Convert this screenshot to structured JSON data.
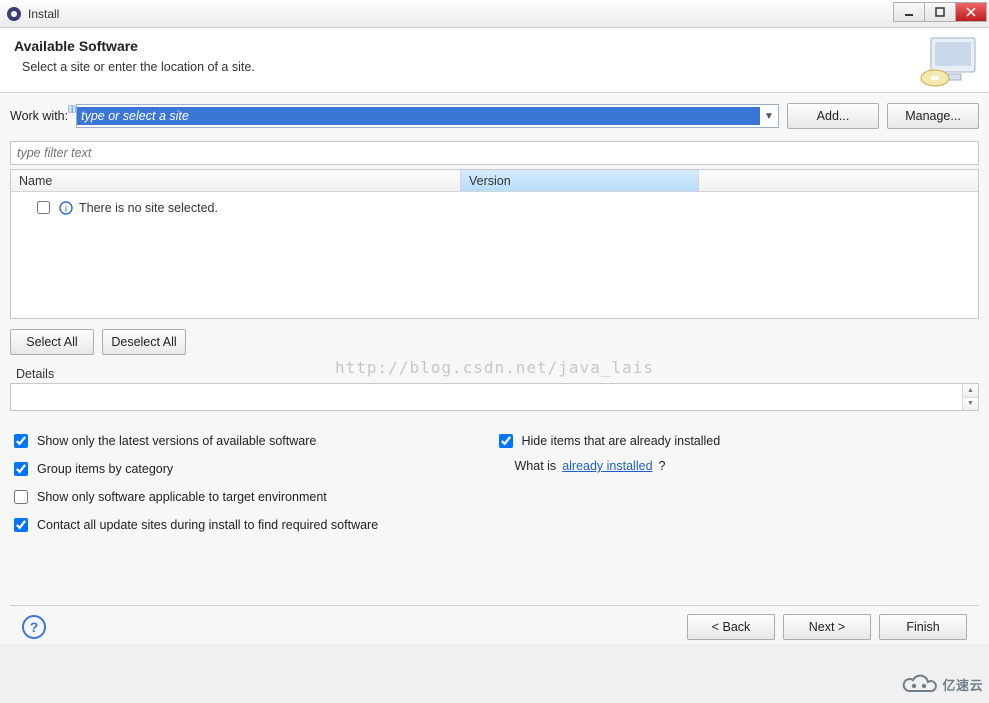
{
  "window": {
    "title": "Install"
  },
  "header": {
    "title": "Available Software",
    "subtitle": "Select a site or enter the location of a site."
  },
  "workwith": {
    "label": "Work with:",
    "placeholder": "type or select a site",
    "add": "Add...",
    "manage": "Manage..."
  },
  "filter": {
    "placeholder": "type filter text"
  },
  "table": {
    "col_name": "Name",
    "col_version": "Version",
    "empty_msg": "There is no site selected."
  },
  "watermark": "http://blog.csdn.net/java_lais",
  "buttons": {
    "select_all": "Select All",
    "deselect_all": "Deselect All"
  },
  "details": {
    "label": "Details"
  },
  "opts": {
    "latest": "Show only the latest versions of available software",
    "group": "Group items by category",
    "applicable": "Show only software applicable to target environment",
    "contact": "Contact all update sites during install to find required software",
    "hide": "Hide items that are already installed",
    "whatis_pre": "What is ",
    "whatis_link": "already installed",
    "whatis_post": "?"
  },
  "footer": {
    "back": "< Back",
    "next": "Next >",
    "finish": "Finish"
  },
  "cloud_label": "亿速云"
}
